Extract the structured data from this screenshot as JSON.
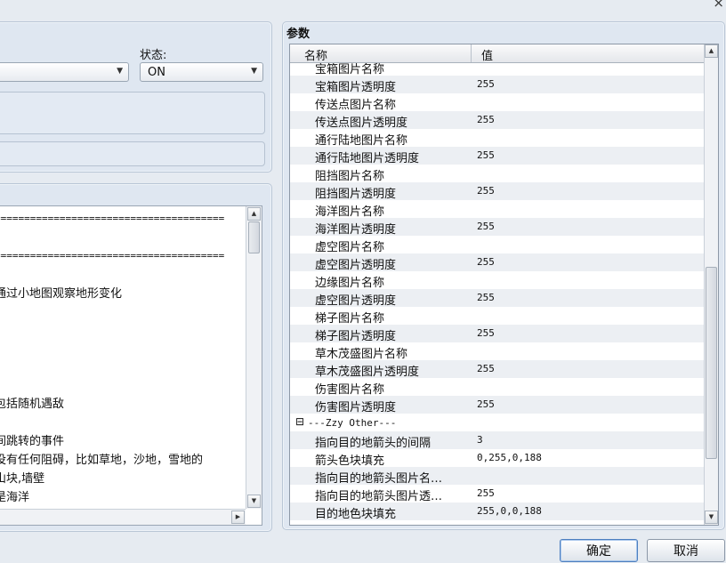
{
  "window": {
    "close_glyph": "×"
  },
  "left_panel": {
    "status_label": "状态:",
    "status_value": "ON"
  },
  "text_area": {
    "lines": [
      "=======================================",
      "=======================================",
      "通过小地图观察地形变化",
      "包括随机遇敌",
      "间跳转的事件",
      "没有任何阻碍，比如草地，沙地，雪地的",
      "山块,墙壁",
      "是海洋"
    ]
  },
  "params": {
    "title": "参数",
    "col_name": "名称",
    "col_value": "值",
    "rows": [
      {
        "name": "宝箱图片名称",
        "value": ""
      },
      {
        "name": "宝箱图片透明度",
        "value": "255"
      },
      {
        "name": "传送点图片名称",
        "value": ""
      },
      {
        "name": "传送点图片透明度",
        "value": "255"
      },
      {
        "name": "通行陆地图片名称",
        "value": ""
      },
      {
        "name": "通行陆地图片透明度",
        "value": "255"
      },
      {
        "name": "阻挡图片名称",
        "value": ""
      },
      {
        "name": "阻挡图片透明度",
        "value": "255"
      },
      {
        "name": "海洋图片名称",
        "value": ""
      },
      {
        "name": "海洋图片透明度",
        "value": "255"
      },
      {
        "name": "虚空图片名称",
        "value": ""
      },
      {
        "name": "虚空图片透明度",
        "value": "255"
      },
      {
        "name": "边缘图片名称",
        "value": ""
      },
      {
        "name": "虚空图片透明度",
        "value": "255"
      },
      {
        "name": "梯子图片名称",
        "value": ""
      },
      {
        "name": "梯子图片透明度",
        "value": "255"
      },
      {
        "name": "草木茂盛图片名称",
        "value": ""
      },
      {
        "name": "草木茂盛图片透明度",
        "value": "255"
      },
      {
        "name": "伤害图片名称",
        "value": ""
      },
      {
        "name": "伤害图片透明度",
        "value": "255"
      },
      {
        "name": "---Zzy Other---",
        "value": "",
        "group": true
      },
      {
        "name": "指向目的地箭头的间隔",
        "value": "3"
      },
      {
        "name": "箭头色块填充",
        "value": "0,255,0,188"
      },
      {
        "name": "指向目的地箭头图片名…",
        "value": ""
      },
      {
        "name": "指向目的地箭头图片透…",
        "value": "255"
      },
      {
        "name": "目的地色块填充",
        "value": "255,0,0,188"
      }
    ]
  },
  "footer": {
    "ok_label": "确定",
    "cancel_label": "取消"
  },
  "icons": {
    "up": "▲",
    "down": "▼",
    "right": "▶",
    "left": "◀",
    "dropdown": "▼",
    "collapse": "⊟"
  }
}
